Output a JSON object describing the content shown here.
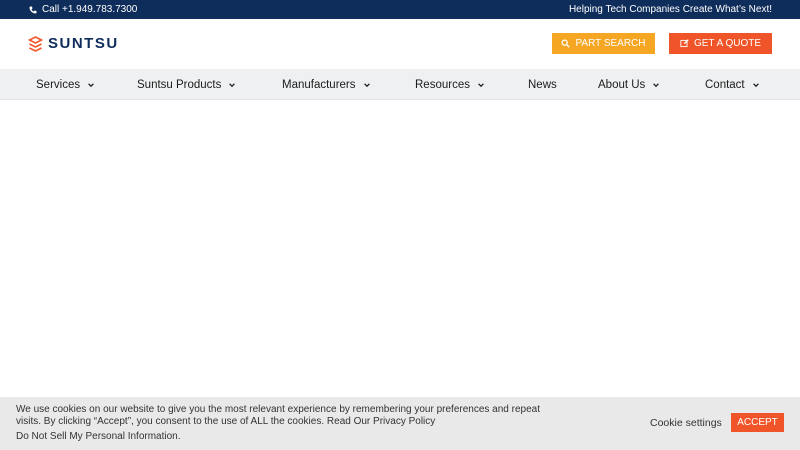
{
  "topbar": {
    "call_label": "Call +1.949.783.7300",
    "tagline": "Helping Tech Companies Create What’s Next!",
    "background": "#0f2d5a"
  },
  "header": {
    "logo_text": "SUNTSU",
    "part_search_label": "PART SEARCH",
    "get_quote_label": "GET A QUOTE",
    "part_search_color": "#f5a623",
    "get_quote_color": "#f0552a"
  },
  "nav": {
    "items": [
      {
        "label": "Services",
        "dropdown": true
      },
      {
        "label": "Suntsu Products",
        "dropdown": true
      },
      {
        "label": "Manufacturers",
        "dropdown": true
      },
      {
        "label": "Resources",
        "dropdown": true
      },
      {
        "label": "News",
        "dropdown": false
      },
      {
        "label": "About Us",
        "dropdown": true
      },
      {
        "label": "Contact",
        "dropdown": true
      }
    ]
  },
  "cookie": {
    "message": "We use cookies on our website to give you the most relevant experience by remembering your preferences and repeat visits. By clicking “Accept”, you consent to the use of ALL the cookies.",
    "privacy_link": "Read Our Privacy Policy",
    "do_not_sell": "Do Not Sell My Personal Information.",
    "settings_label": "Cookie settings",
    "accept_label": "ACCEPT"
  },
  "icons": {
    "phone": "phone-icon",
    "search": "search-icon",
    "edit": "edit-icon",
    "chevron": "chevron-down-icon",
    "logo_mark": "suntsu-logo-mark"
  }
}
